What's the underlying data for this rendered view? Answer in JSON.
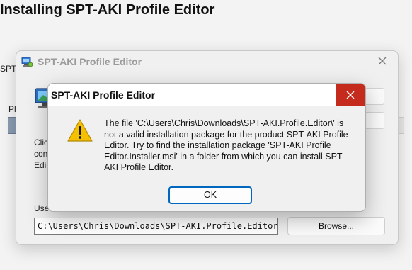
{
  "background_window": {
    "title": "Installing SPT-AKI Profile Editor",
    "fragments": [
      "SPT",
      "Pl",
      "Clic",
      "con",
      "Edi",
      "Use"
    ]
  },
  "editor_window": {
    "title": "SPT-AKI Profile Editor",
    "path_value": "C:\\Users\\Chris\\Downloads\\SPT-AKI.Profile.Editor\\",
    "browse_label": "Browse...",
    "icons": [
      "installer-icon",
      "close-icon",
      "computer-logo-icon"
    ]
  },
  "error_dialog": {
    "title": "SPT-AKI Profile Editor",
    "message": "The file 'C:\\Users\\Chris\\Downloads\\SPT-AKI.Profile.Editor\\' is not a valid installation package for the product SPT-AKI Profile Editor. Try to find the installation package 'SPT-AKI Profile Editor.Installer.msi' in a folder from which you can install SPT-AKI Profile Editor.",
    "ok_label": "OK",
    "icons": [
      "warning-icon",
      "close-icon"
    ]
  },
  "colors": {
    "close_hover_red": "#c42b1c",
    "warning_yellow": "#f5c000",
    "focus_blue": "#0067c0"
  }
}
